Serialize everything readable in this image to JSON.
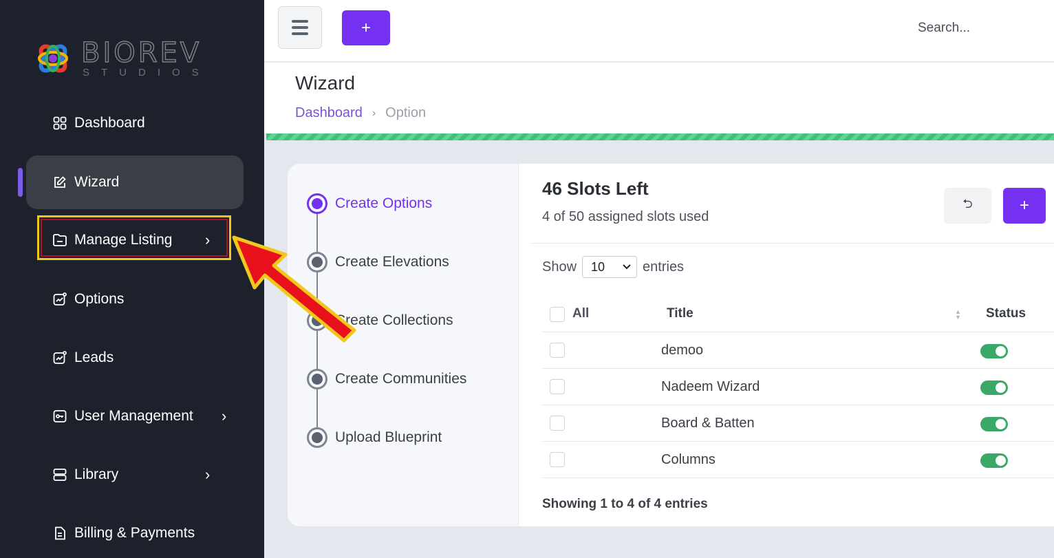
{
  "brand": {
    "name": "BIOREV",
    "subtitle": "STUDIOS"
  },
  "sidebar": {
    "items": [
      {
        "label": "Dashboard",
        "icon": "grid-icon"
      },
      {
        "label": "Wizard",
        "icon": "edit-icon",
        "active": true
      },
      {
        "label": "Manage Listing",
        "icon": "folder-icon",
        "has_submenu": true
      },
      {
        "label": "Options",
        "icon": "chart-icon"
      },
      {
        "label": "Leads",
        "icon": "chart-icon"
      },
      {
        "label": "User Management",
        "icon": "key-icon",
        "has_submenu": true
      },
      {
        "label": "Library",
        "icon": "server-icon",
        "has_submenu": true
      },
      {
        "label": "Billing & Payments",
        "icon": "invoice-icon"
      }
    ],
    "chevron": "›"
  },
  "topbar": {
    "add_label": "+",
    "search_placeholder": "Search..."
  },
  "header": {
    "title": "Wizard",
    "breadcrumb": {
      "home": "Dashboard",
      "separator": "›",
      "current": "Option"
    }
  },
  "steps": [
    {
      "label": "Create Options",
      "active": true
    },
    {
      "label": "Create Elevations"
    },
    {
      "label": "Create Collections"
    },
    {
      "label": "Create Communities"
    },
    {
      "label": "Upload Blueprint"
    }
  ],
  "slots": {
    "title": "46 Slots Left",
    "subtitle": "4 of 50 assigned slots used",
    "undo_icon": "⮌",
    "add_label": "+"
  },
  "table_controls": {
    "show_label": "Show",
    "page_size": "10",
    "entries_label": "entries"
  },
  "table": {
    "headers": {
      "all": "All",
      "title": "Title",
      "status": "Status"
    },
    "rows": [
      {
        "title": "demoo",
        "status_on": true
      },
      {
        "title": "Nadeem Wizard",
        "status_on": true
      },
      {
        "title": "Board & Batten",
        "status_on": true
      },
      {
        "title": "Columns",
        "status_on": true
      }
    ]
  },
  "footer": {
    "info": "Showing 1 to 4 of 4 entries"
  },
  "colors": {
    "accent": "#7431f1",
    "sidebar_bg": "#1d212b",
    "toggle_on": "#3aa866",
    "highlight_border": "#f2c81c",
    "arrow": "#e8101b"
  }
}
